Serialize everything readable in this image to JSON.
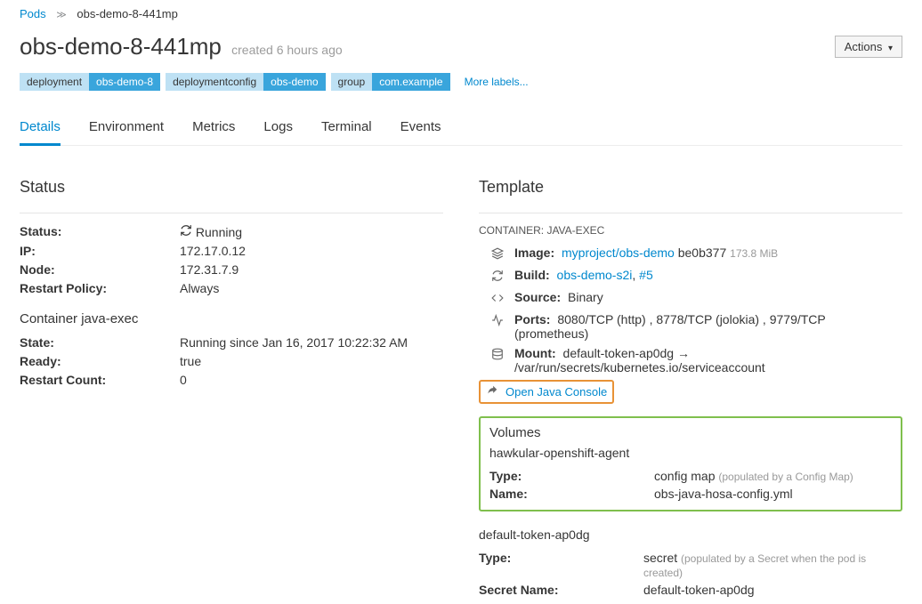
{
  "breadcrumb": {
    "root": "Pods",
    "current": "obs-demo-8-441mp"
  },
  "title": "obs-demo-8-441mp",
  "title_sub": "created 6 hours ago",
  "actions_label": "Actions",
  "labels": [
    {
      "key": "deployment",
      "val": "obs-demo-8"
    },
    {
      "key": "deploymentconfig",
      "val": "obs-demo"
    },
    {
      "key": "group",
      "val": "com.example"
    }
  ],
  "more_labels": "More labels...",
  "tabs": [
    "Details",
    "Environment",
    "Metrics",
    "Logs",
    "Terminal",
    "Events"
  ],
  "status_section": {
    "heading": "Status",
    "rows": {
      "status_k": "Status:",
      "status_v": "Running",
      "ip_k": "IP:",
      "ip_v": "172.17.0.12",
      "node_k": "Node:",
      "node_v": "172.31.7.9",
      "restart_policy_k": "Restart Policy:",
      "restart_policy_v": "Always"
    },
    "container_heading": "Container java-exec",
    "container_rows": {
      "state_k": "State:",
      "state_v": "Running since Jan 16, 2017 10:22:32 AM",
      "ready_k": "Ready:",
      "ready_v": "true",
      "rc_k": "Restart Count:",
      "rc_v": "0"
    }
  },
  "template_section": {
    "heading": "Template",
    "container_label": "CONTAINER: JAVA-EXEC",
    "image_k": "Image:",
    "image_link": "myproject/obs-demo",
    "image_sha": "be0b377",
    "image_size": "173.8 MiB",
    "build_k": "Build:",
    "build_link1": "obs-demo-s2i",
    "build_sep": ", ",
    "build_link2": "#5",
    "source_k": "Source:",
    "source_v": "Binary",
    "ports_k": "Ports:",
    "ports_v": "8080/TCP (http) , 8778/TCP (jolokia) , 9779/TCP (prometheus)",
    "mount_k": "Mount:",
    "mount_v": "default-token-ap0dg → /var/run/secrets/kubernetes.io/serviceaccount",
    "java_console": "Open Java Console",
    "volumes_heading": "Volumes",
    "vol1_name": "hawkular-openshift-agent",
    "vol1_type_k": "Type:",
    "vol1_type_v": "config map",
    "vol1_type_hint": "(populated by a Config Map)",
    "vol1_name_k": "Name:",
    "vol1_name_v": "obs-java-hosa-config.yml",
    "vol2_name": "default-token-ap0dg",
    "vol2_type_k": "Type:",
    "vol2_type_v": "secret",
    "vol2_type_hint": "(populated by a Secret when the pod is created)",
    "vol2_name_k": "Secret Name:",
    "vol2_name_v": "default-token-ap0dg"
  }
}
